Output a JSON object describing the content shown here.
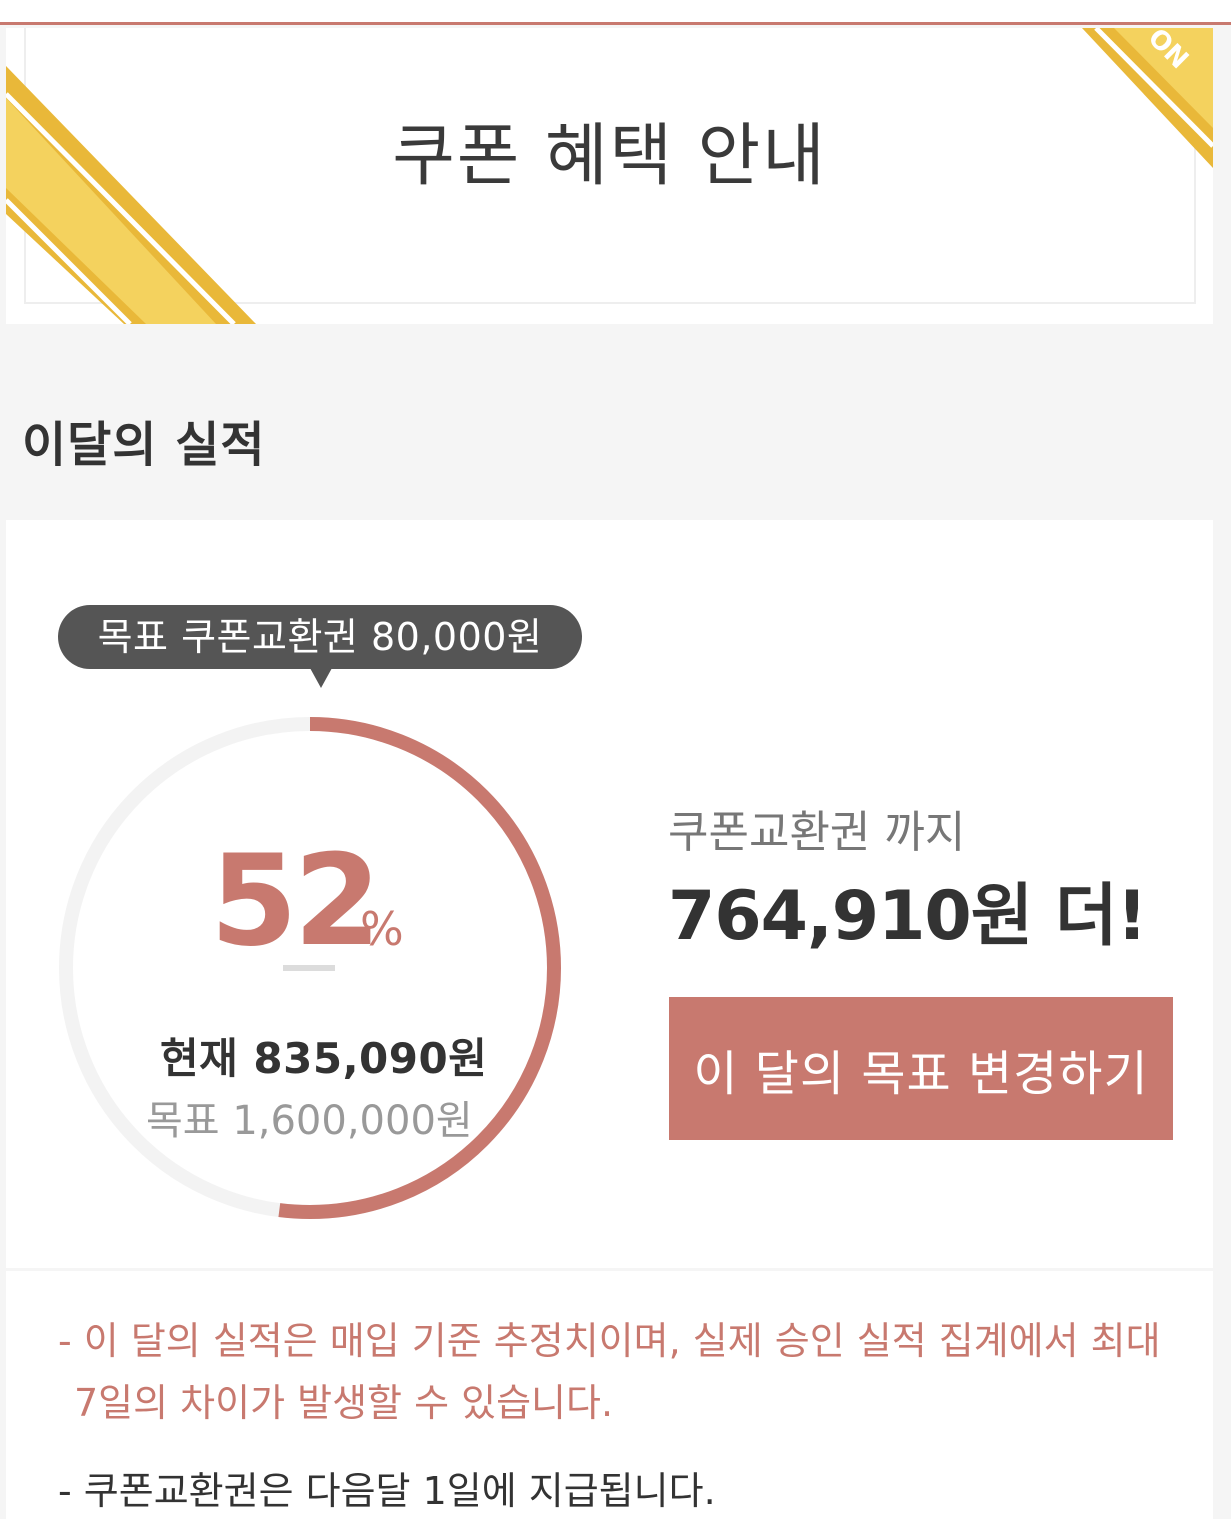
{
  "header": {
    "title": "쿠폰 혜택 안내",
    "ribbon_text": "ON",
    "ribbon_color": "#f2c94c"
  },
  "performance": {
    "section_title": "이달의 실적",
    "tooltip": "목표 쿠폰교환권 80,000원",
    "percent_value": "52",
    "percent_sign": "%",
    "progress_fraction": 0.52,
    "current_label": "현재 835,090원",
    "goal_label": "목표 1,600,000원",
    "until_label": "쿠폰교환권 까지",
    "remaining_label": "764,910원 더!",
    "change_button_label": "이 달의 목표 변경하기"
  },
  "notes": {
    "line1_a": "- 이 달의 실적은 매입 기준 추정치이며, 실제 승인 실적 집계에서 최대",
    "line1_b": "7일의 차이가 발생할 수 있습니다.",
    "line2": "- 쿠폰교환권은 다음달 1일에 지급됩니다."
  },
  "colors": {
    "accent": "#c8796f",
    "tooltip_bg": "#555555",
    "track": "#f3f3f3"
  }
}
